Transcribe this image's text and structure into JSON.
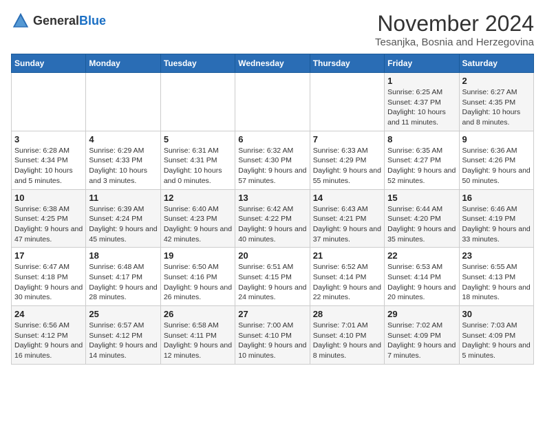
{
  "logo": {
    "general": "General",
    "blue": "Blue"
  },
  "title": "November 2024",
  "subtitle": "Tesanjka, Bosnia and Herzegovina",
  "days_of_week": [
    "Sunday",
    "Monday",
    "Tuesday",
    "Wednesday",
    "Thursday",
    "Friday",
    "Saturday"
  ],
  "weeks": [
    [
      {
        "day": "",
        "info": ""
      },
      {
        "day": "",
        "info": ""
      },
      {
        "day": "",
        "info": ""
      },
      {
        "day": "",
        "info": ""
      },
      {
        "day": "",
        "info": ""
      },
      {
        "day": "1",
        "info": "Sunrise: 6:25 AM\nSunset: 4:37 PM\nDaylight: 10 hours and 11 minutes."
      },
      {
        "day": "2",
        "info": "Sunrise: 6:27 AM\nSunset: 4:35 PM\nDaylight: 10 hours and 8 minutes."
      }
    ],
    [
      {
        "day": "3",
        "info": "Sunrise: 6:28 AM\nSunset: 4:34 PM\nDaylight: 10 hours and 5 minutes."
      },
      {
        "day": "4",
        "info": "Sunrise: 6:29 AM\nSunset: 4:33 PM\nDaylight: 10 hours and 3 minutes."
      },
      {
        "day": "5",
        "info": "Sunrise: 6:31 AM\nSunset: 4:31 PM\nDaylight: 10 hours and 0 minutes."
      },
      {
        "day": "6",
        "info": "Sunrise: 6:32 AM\nSunset: 4:30 PM\nDaylight: 9 hours and 57 minutes."
      },
      {
        "day": "7",
        "info": "Sunrise: 6:33 AM\nSunset: 4:29 PM\nDaylight: 9 hours and 55 minutes."
      },
      {
        "day": "8",
        "info": "Sunrise: 6:35 AM\nSunset: 4:27 PM\nDaylight: 9 hours and 52 minutes."
      },
      {
        "day": "9",
        "info": "Sunrise: 6:36 AM\nSunset: 4:26 PM\nDaylight: 9 hours and 50 minutes."
      }
    ],
    [
      {
        "day": "10",
        "info": "Sunrise: 6:38 AM\nSunset: 4:25 PM\nDaylight: 9 hours and 47 minutes."
      },
      {
        "day": "11",
        "info": "Sunrise: 6:39 AM\nSunset: 4:24 PM\nDaylight: 9 hours and 45 minutes."
      },
      {
        "day": "12",
        "info": "Sunrise: 6:40 AM\nSunset: 4:23 PM\nDaylight: 9 hours and 42 minutes."
      },
      {
        "day": "13",
        "info": "Sunrise: 6:42 AM\nSunset: 4:22 PM\nDaylight: 9 hours and 40 minutes."
      },
      {
        "day": "14",
        "info": "Sunrise: 6:43 AM\nSunset: 4:21 PM\nDaylight: 9 hours and 37 minutes."
      },
      {
        "day": "15",
        "info": "Sunrise: 6:44 AM\nSunset: 4:20 PM\nDaylight: 9 hours and 35 minutes."
      },
      {
        "day": "16",
        "info": "Sunrise: 6:46 AM\nSunset: 4:19 PM\nDaylight: 9 hours and 33 minutes."
      }
    ],
    [
      {
        "day": "17",
        "info": "Sunrise: 6:47 AM\nSunset: 4:18 PM\nDaylight: 9 hours and 30 minutes."
      },
      {
        "day": "18",
        "info": "Sunrise: 6:48 AM\nSunset: 4:17 PM\nDaylight: 9 hours and 28 minutes."
      },
      {
        "day": "19",
        "info": "Sunrise: 6:50 AM\nSunset: 4:16 PM\nDaylight: 9 hours and 26 minutes."
      },
      {
        "day": "20",
        "info": "Sunrise: 6:51 AM\nSunset: 4:15 PM\nDaylight: 9 hours and 24 minutes."
      },
      {
        "day": "21",
        "info": "Sunrise: 6:52 AM\nSunset: 4:14 PM\nDaylight: 9 hours and 22 minutes."
      },
      {
        "day": "22",
        "info": "Sunrise: 6:53 AM\nSunset: 4:14 PM\nDaylight: 9 hours and 20 minutes."
      },
      {
        "day": "23",
        "info": "Sunrise: 6:55 AM\nSunset: 4:13 PM\nDaylight: 9 hours and 18 minutes."
      }
    ],
    [
      {
        "day": "24",
        "info": "Sunrise: 6:56 AM\nSunset: 4:12 PM\nDaylight: 9 hours and 16 minutes."
      },
      {
        "day": "25",
        "info": "Sunrise: 6:57 AM\nSunset: 4:12 PM\nDaylight: 9 hours and 14 minutes."
      },
      {
        "day": "26",
        "info": "Sunrise: 6:58 AM\nSunset: 4:11 PM\nDaylight: 9 hours and 12 minutes."
      },
      {
        "day": "27",
        "info": "Sunrise: 7:00 AM\nSunset: 4:10 PM\nDaylight: 9 hours and 10 minutes."
      },
      {
        "day": "28",
        "info": "Sunrise: 7:01 AM\nSunset: 4:10 PM\nDaylight: 9 hours and 8 minutes."
      },
      {
        "day": "29",
        "info": "Sunrise: 7:02 AM\nSunset: 4:09 PM\nDaylight: 9 hours and 7 minutes."
      },
      {
        "day": "30",
        "info": "Sunrise: 7:03 AM\nSunset: 4:09 PM\nDaylight: 9 hours and 5 minutes."
      }
    ]
  ]
}
